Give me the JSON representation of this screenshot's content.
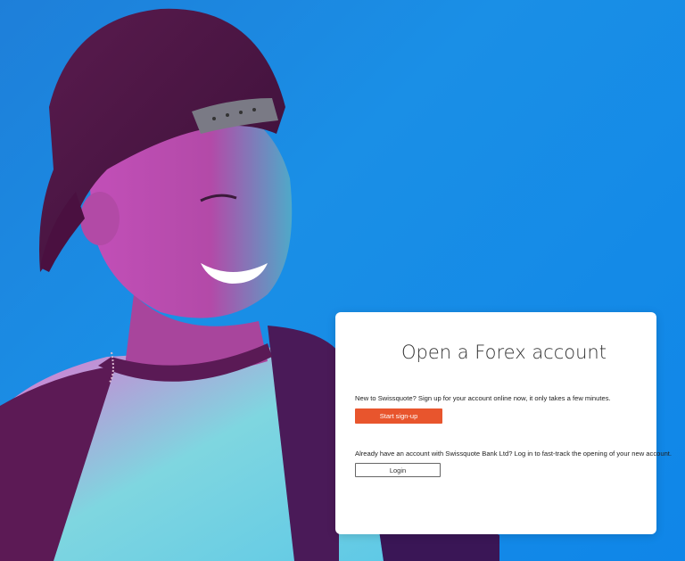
{
  "hero": {
    "image": "smiling-man-in-backwards-cap",
    "background_color": "#1a8fe6"
  },
  "card": {
    "title": "Open a Forex account",
    "signup": {
      "text": "New to Swissquote? Sign up for your account online now, it only takes a few minutes.",
      "button_label": "Start sign-up",
      "button_color": "#e8552d"
    },
    "login": {
      "text": "Already have an account with Swissquote Bank Ltd? Log in to fast-track the opening of your new account.",
      "button_label": "Login"
    }
  }
}
